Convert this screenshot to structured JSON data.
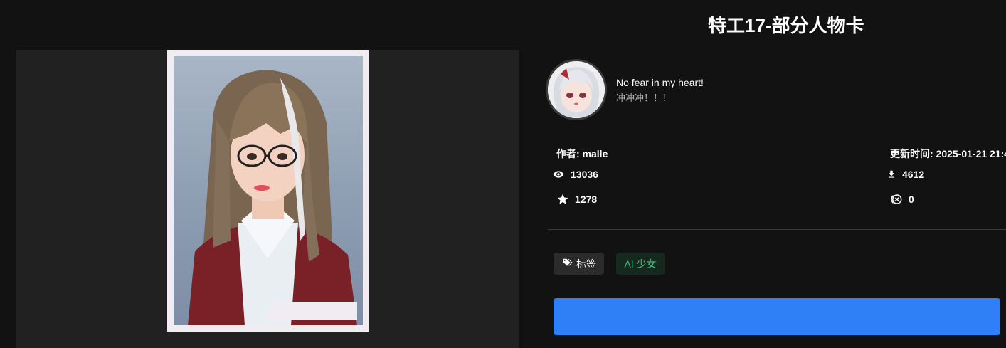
{
  "page": {
    "title": "特工17-部分人物卡"
  },
  "author": {
    "bio_name": "No fear in my heart!",
    "bio_text": "冲冲冲！！！",
    "author_line": "作者: malle",
    "updated_line": "更新时间: 2025-01-21 21:4"
  },
  "stats": {
    "views": "13036",
    "downloads": "4612",
    "stars": "1278",
    "reports": "0"
  },
  "tags": {
    "label": "标签",
    "items": [
      "AI 少女"
    ]
  },
  "colors": {
    "background": "#121212",
    "panel": "#212121",
    "button": "#2f7ff6",
    "tag_text": "#4bc287",
    "tag_bg": "#16291f"
  },
  "icons": [
    "eye-icon",
    "download-icon",
    "star-icon",
    "block-icon",
    "tag-icon"
  ]
}
